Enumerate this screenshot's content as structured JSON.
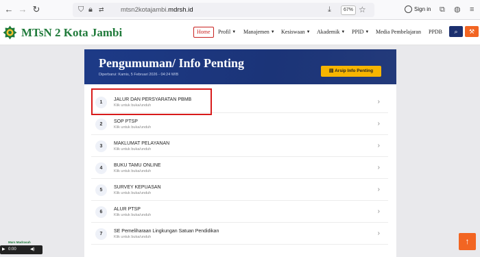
{
  "browser": {
    "url_prefix": "mtsn2kotajambi.",
    "url_domain": "mdrsh.id",
    "zoom": "67%",
    "signin_label": "Sign in"
  },
  "header": {
    "site_title": "MTsN 2 Kota Jambi",
    "nav": [
      {
        "label": "Home",
        "has_caret": false
      },
      {
        "label": "Profil",
        "has_caret": true
      },
      {
        "label": "Manajemen",
        "has_caret": true
      },
      {
        "label": "Kesiswaan",
        "has_caret": true
      },
      {
        "label": "Akademik",
        "has_caret": true
      },
      {
        "label": "PPID",
        "has_caret": true
      },
      {
        "label": "Media Pembelajaran",
        "has_caret": false
      },
      {
        "label": "PPDB",
        "has_caret": false
      }
    ],
    "search_icon": "search-icon",
    "tool_icon": "wrench-icon",
    "colors": {
      "brand_green": "#1f7a3a",
      "active_red": "#c8201e",
      "search_bg": "#1b2f6e",
      "tool_bg": "#f26522"
    }
  },
  "banner": {
    "title": "Pengumuman/ Info Penting",
    "updated": "Diperbarui: Kamis, 5 Februari 2026 - 04:24 WIB",
    "archive_button": "Arsip Info Penting"
  },
  "announcements": [
    {
      "num": "1",
      "title": "JALUR DAN PERSYARATAN PBMB",
      "subtitle": "Klik untuk buka/unduh"
    },
    {
      "num": "2",
      "title": "SOP PTSP",
      "subtitle": "Klik untuk buka/unduh"
    },
    {
      "num": "3",
      "title": "MAKLUMAT PELAYANAN",
      "subtitle": "Klik untuk buka/unduh"
    },
    {
      "num": "4",
      "title": "BUKU TAMU ONLINE",
      "subtitle": "Klik untuk buka/unduh"
    },
    {
      "num": "5",
      "title": "SURVEY KEPUASAN",
      "subtitle": "Klik untuk buka/unduh"
    },
    {
      "num": "6",
      "title": "ALUR PTSP",
      "subtitle": "Klik untuk buka/unduh"
    },
    {
      "num": "7",
      "title": "SE Pemeliharaan Lingkungan Satuan Pendidikan",
      "subtitle": "Klik untuk buka/unduh"
    }
  ],
  "media_player": {
    "label": "Mars Madrasah",
    "time": "0:00"
  }
}
